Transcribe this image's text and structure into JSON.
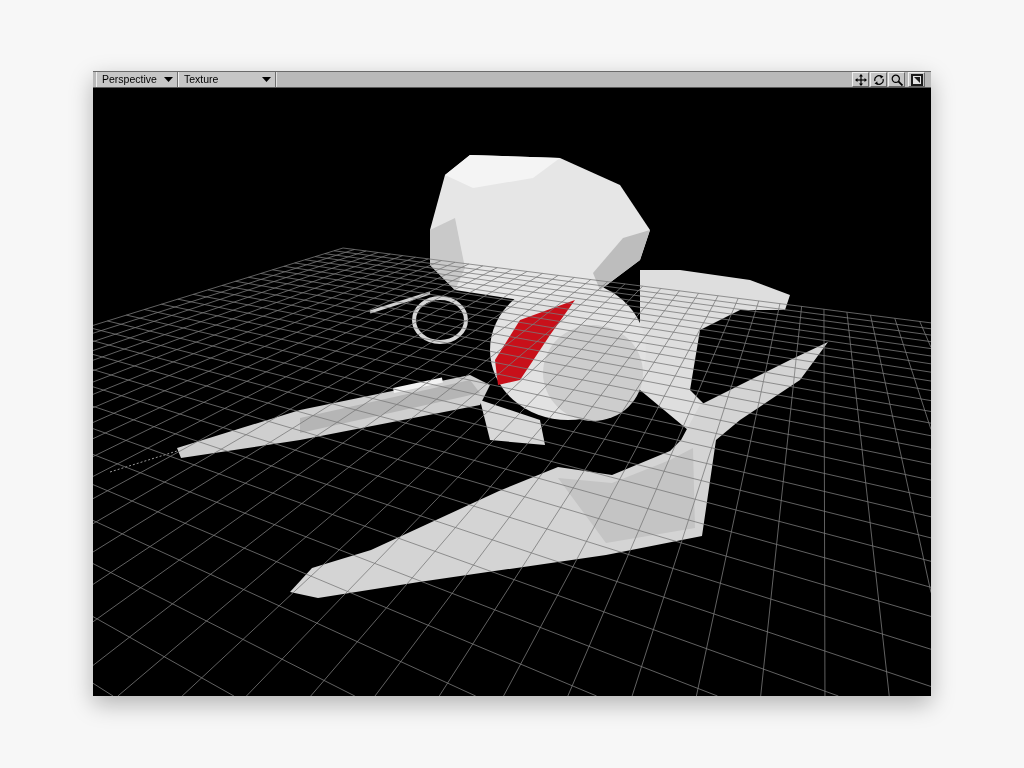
{
  "viewport": {
    "toolbar": {
      "view_menu": {
        "label": "Perspective"
      },
      "render_menu": {
        "label": "Texture"
      },
      "tools": [
        {
          "kind": "move"
        },
        {
          "kind": "rotate"
        },
        {
          "kind": "zoom"
        },
        {
          "kind": "maximize"
        }
      ]
    }
  }
}
